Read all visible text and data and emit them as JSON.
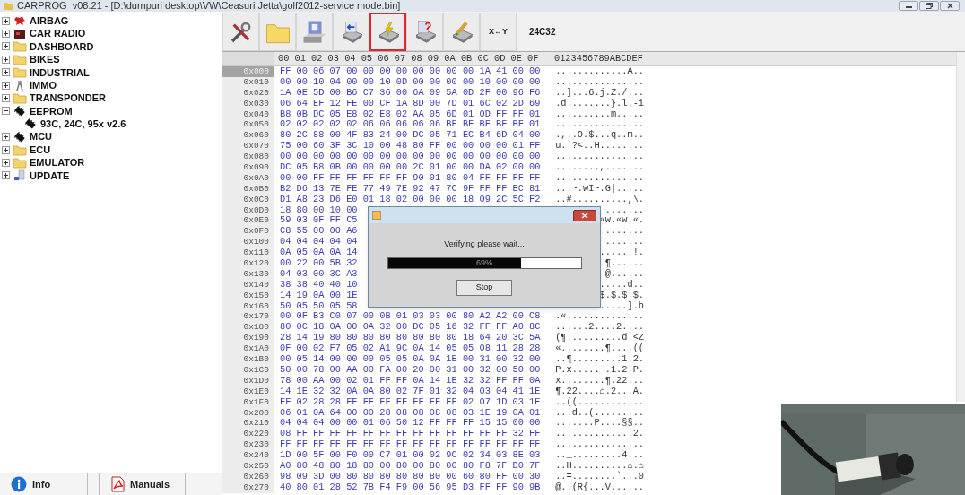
{
  "window": {
    "title": "CARPROG  v08.21 - [D:\\durnpuri desktop\\VW\\Ceasuri Jetta\\golf2012-service mode.bin]"
  },
  "tree": [
    {
      "label": "AIRBAG",
      "kind": "airbag",
      "expanded": false
    },
    {
      "label": "CAR RADIO",
      "kind": "radio",
      "expanded": false
    },
    {
      "label": "DASHBOARD",
      "kind": "folder",
      "expanded": false
    },
    {
      "label": "BIKES",
      "kind": "folder",
      "expanded": false
    },
    {
      "label": "INDUSTRIAL",
      "kind": "folder",
      "expanded": false
    },
    {
      "label": "IMMO",
      "kind": "immo",
      "expanded": false
    },
    {
      "label": "TRANSPONDER",
      "kind": "folder",
      "expanded": false
    },
    {
      "label": "EEPROM",
      "kind": "chip",
      "expanded": true,
      "children": [
        {
          "label": "93C, 24C, 95x v2.6",
          "kind": "chip"
        }
      ]
    },
    {
      "label": "MCU",
      "kind": "chip",
      "expanded": false
    },
    {
      "label": "ECU",
      "kind": "folder",
      "expanded": false
    },
    {
      "label": "EMULATOR",
      "kind": "folder",
      "expanded": false
    },
    {
      "label": "UPDATE",
      "kind": "update",
      "expanded": false
    }
  ],
  "bottom_tabs": [
    {
      "label": "Info",
      "kind": "info"
    },
    {
      "label": "Manuals",
      "kind": "pdf"
    }
  ],
  "toolbar": [
    {
      "kind": "tools",
      "highlighted": false
    },
    {
      "kind": "open",
      "highlighted": false
    },
    {
      "kind": "save",
      "highlighted": false
    },
    {
      "kind": "read",
      "highlighted": false
    },
    {
      "kind": "write",
      "highlighted": true
    },
    {
      "kind": "verify",
      "highlighted": false
    },
    {
      "kind": "erase",
      "highlighted": false
    },
    {
      "kind": "swap",
      "label": "X↔Y",
      "highlighted": false
    }
  ],
  "chip_name": "24C32",
  "hex": {
    "header": "00 01 02 03 04 05 06 07 08 09 0A 0B 0C 0D 0E 0F",
    "ascii_header": "0123456789ABCDEF",
    "rows": [
      {
        "address": "0x000",
        "selected": true,
        "bytes": "FF 00 06 07 00 00 00 00 00 00 00 00 1A 41 00 00",
        "ascii": ".............A.."
      },
      {
        "address": "0x010",
        "selected": false,
        "bytes": "00 00 10 04 00 00 10 0D 00 00 00 00 10 00 00 00",
        "ascii": "................"
      },
      {
        "address": "0x020",
        "selected": false,
        "bytes": "1A 0E 5D 00 B6 C7 36 00 6A 09 5A 0D 2F 00 96 F6",
        "ascii": "..]...6.j.Z./..."
      },
      {
        "address": "0x030",
        "selected": false,
        "bytes": "06 64 EF 12 FE 00 CF 1A 8D 00 7D 01 6C 02 2D 69",
        "ascii": ".d........}.l.-i"
      },
      {
        "address": "0x040",
        "selected": false,
        "bytes": "B8 0B DC 05 E8 02 E8 02 AA 05 6D 01 0D FF FF 01",
        "ascii": "..........m....."
      },
      {
        "address": "0x050",
        "selected": false,
        "bytes": "02 02 02 02 02 06 06 06 06 06 BF BF BF BF BF 01",
        "ascii": "................"
      },
      {
        "address": "0x060",
        "selected": false,
        "bytes": "80 2C 88 00 4F 83 24 00 DC 05 71 EC B4 6D 04 00",
        "ascii": ".,..O.$...q..m.."
      },
      {
        "address": "0x070",
        "selected": false,
        "bytes": "75 00 60 3F 3C 10 00 48 80 FF 00 00 00 00 01 FF",
        "ascii": "u.`?<..H........"
      },
      {
        "address": "0x080",
        "selected": false,
        "bytes": "00 00 00 00 00 00 00 00 00 00 00 00 00 00 00 00",
        "ascii": "................"
      },
      {
        "address": "0x090",
        "selected": false,
        "bytes": "DC 05 B8 0B 00 00 00 00 2C 01 00 00 DA 02 00 00",
        "ascii": "........,......."
      },
      {
        "address": "0x0A0",
        "selected": false,
        "bytes": "00 00 FF FF FF FF FF FF 90 01 80 04 FF FF FF FF",
        "ascii": "................"
      },
      {
        "address": "0x0B0",
        "selected": false,
        "bytes": "B2 D6 13 7E FE 77 49 7E 92 47 7C 9F FF FF EC 81",
        "ascii": "...~.wI~.G|....."
      },
      {
        "address": "0x0C0",
        "selected": false,
        "bytes": "D1 A8 23 D6 E0 01 18 02 00 00 00 18 09 2C 5C F2",
        "ascii": "..#..........,\\."
      },
      {
        "address": "0x0D0",
        "selected": false,
        "bytes": "18 80 00 10 00",
        "ascii": "......."
      },
      {
        "address": "0x0E0",
        "selected": false,
        "bytes": "59 03 0F FF C5",
        "ascii": "«w.«w.«."
      },
      {
        "address": "0x0F0",
        "selected": false,
        "bytes": "C8 55 00 00 A6",
        "ascii": "......."
      },
      {
        "address": "0x100",
        "selected": false,
        "bytes": "04 04 04 04 04",
        "ascii": "......."
      },
      {
        "address": "0x110",
        "selected": false,
        "bytes": "0A 05 0A 0A 14",
        "ascii": ".....!!."
      },
      {
        "address": "0x120",
        "selected": false,
        "bytes": "00 22 00 5B 32",
        "ascii": "¶......"
      },
      {
        "address": "0x130",
        "selected": false,
        "bytes": "04 03 00 3C A3",
        "ascii": "@......"
      },
      {
        "address": "0x140",
        "selected": false,
        "bytes": "38 38 40 40 10",
        "ascii": ".....d.."
      },
      {
        "address": "0x150",
        "selected": false,
        "bytes": "14 19 0A 00 1E",
        "ascii": "$.$.$.$."
      },
      {
        "address": "0x160",
        "selected": false,
        "bytes": "50 05 50 05 58",
        "ascii": ".....].b"
      },
      {
        "address": "0x170",
        "selected": false,
        "bytes": "00 0F B3 C0 07 00 0B 01 03 03 00 80 A2 A2 00 C8",
        "ascii": ".«.............."
      },
      {
        "address": "0x180",
        "selected": false,
        "bytes": "80 0C 18 0A 00 0A 32 00 DC 05 16 32 FF FF A0 8C",
        "ascii": "......2....2...."
      },
      {
        "address": "0x190",
        "selected": false,
        "bytes": "28 14 19 80 80 80 80 80 80 80 80 18 64 20 3C 5A",
        "ascii": "(¶..........d <Z"
      },
      {
        "address": "0x1A0",
        "selected": false,
        "bytes": "0F 00 02 F7 05 02 A1 9C 0A 14 05 05 08 11 28 28",
        "ascii": "«........¶....(("
      },
      {
        "address": "0x1B0",
        "selected": false,
        "bytes": "00 05 14 00 00 00 05 05 0A 0A 1E 00 31 00 32 00",
        "ascii": "..¶.........1.2."
      },
      {
        "address": "0x1C0",
        "selected": false,
        "bytes": "50 00 78 00 AA 00 FA 00 20 00 31 00 32 00 50 00",
        "ascii": "P.x..... .1.2.P."
      },
      {
        "address": "0x1D0",
        "selected": false,
        "bytes": "78 00 AA 00 02 01 FF FF 0A 14 1E 32 32 FF FF 0A",
        "ascii": "x........¶.22..."
      },
      {
        "address": "0x1E0",
        "selected": false,
        "bytes": "14 1E 32 32 0A 0A 80 02 7F 01 32 04 03 04 41 1E",
        "ascii": "¶.22....⌂.2...A."
      },
      {
        "address": "0x1F0",
        "selected": false,
        "bytes": "FF 02 28 28 FF FF FF FF FF FF FF 02 07 1D 03 1E",
        "ascii": "..((............"
      },
      {
        "address": "0x200",
        "selected": false,
        "bytes": "06 01 0A 64 00 00 28 08 08 08 08 03 1E 19 0A 01",
        "ascii": "...d..(........."
      },
      {
        "address": "0x210",
        "selected": false,
        "bytes": "04 04 04 00 00 01 06 50 12 FF FF FF 15 15 00 00",
        "ascii": ".......P....§§.."
      },
      {
        "address": "0x220",
        "selected": false,
        "bytes": "08 FF FF FF FF FF FF FF FF FF FF FF FF FF 32 FF",
        "ascii": "..............2."
      },
      {
        "address": "0x230",
        "selected": false,
        "bytes": "FF FF FF FF FF FF FF FF FF FF FF FF FF FF FF FF",
        "ascii": "................"
      },
      {
        "address": "0x240",
        "selected": false,
        "bytes": "1D 00 5F 00 F0 00 C7 01 00 02 9C 02 34 03 8E 03",
        "ascii": ".._.........4..."
      },
      {
        "address": "0x250",
        "selected": false,
        "bytes": "A0 80 48 80 18 80 00 80 00 80 00 80 F8 7F D0 7F",
        "ascii": "..H..........⌂.⌂"
      },
      {
        "address": "0x260",
        "selected": false,
        "bytes": "98 09 3D 00 80 80 80 80 80 80 00 60 80 FF 00 30",
        "ascii": "..=........`...0"
      },
      {
        "address": "0x270",
        "selected": false,
        "bytes": "40 80 01 28 52 7B F4 F9 00 56 95 D3 FF FF 90 9B",
        "ascii": "@..(R{...V......"
      }
    ]
  },
  "dialog": {
    "message": "Verifying please wait...",
    "progress": {
      "level": 0.69,
      "text": "69%"
    },
    "button": "Stop"
  }
}
